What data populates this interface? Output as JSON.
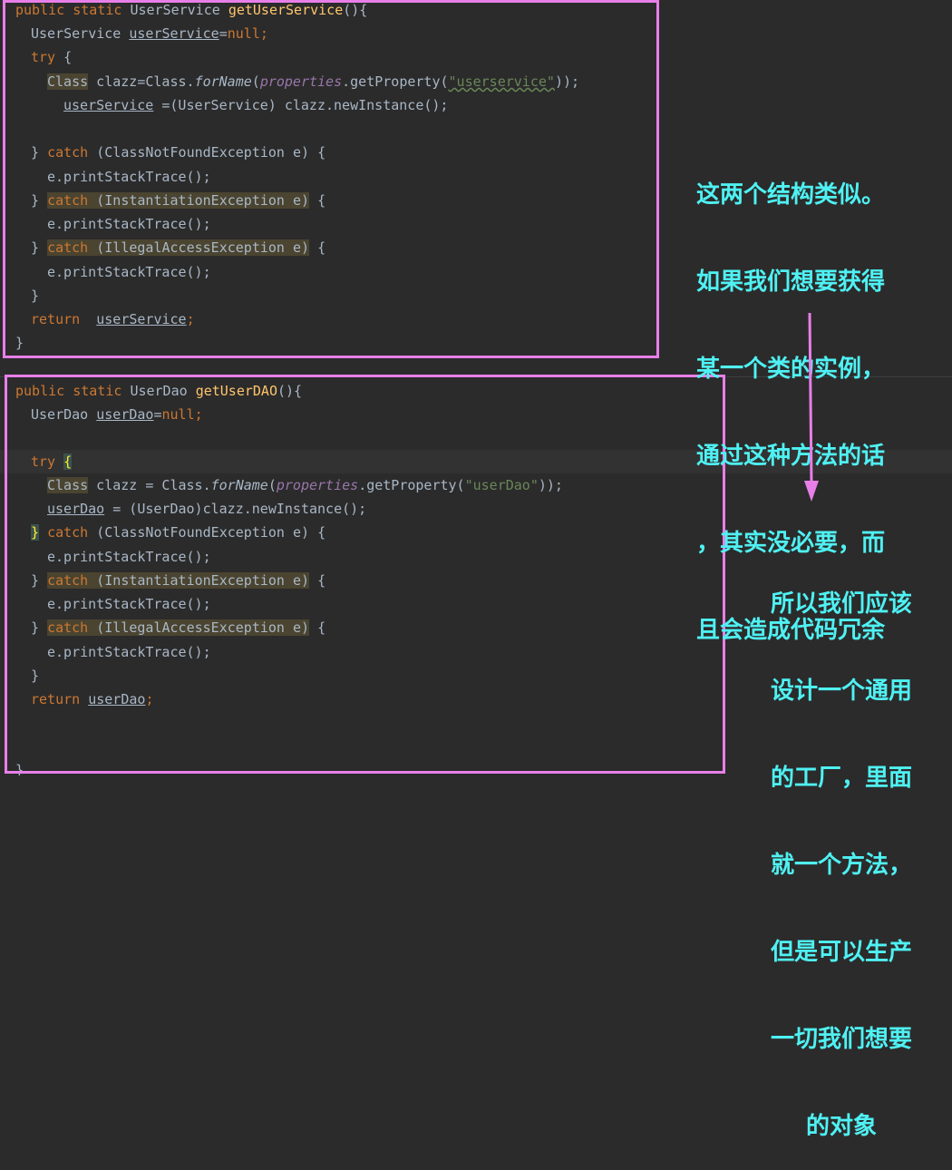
{
  "colors": {
    "background": "#2b2b2b",
    "keyword": "#cc7832",
    "function": "#ffc66d",
    "string": "#6a8759",
    "field": "#9876aa",
    "frame": "#e87fe8",
    "annotation": "#4ff1f3"
  },
  "code1": {
    "l1": {
      "kw": "public static",
      "type": "UserService",
      "fn": "getUserService",
      "rest": "(){"
    },
    "l2": {
      "type": "UserService",
      "var": "userService",
      "eq": "=",
      "nul": "null",
      "semi": ";"
    },
    "l3": {
      "kw": "try",
      "rest": " {"
    },
    "l4": {
      "cls": "Class",
      "a": " clazz=Class.",
      "m": "forName",
      "b": "(",
      "f": "properties",
      "c": ".getProperty(",
      "s": "\"userservice\"",
      "d": "));"
    },
    "l5": {
      "var": "userService",
      "rest": " =(UserService) clazz.newInstance();"
    },
    "l7": {
      "a": "} ",
      "kw": "catch",
      "b": " (ClassNotFoundException e) {"
    },
    "l8": "e.printStackTrace();",
    "l9": {
      "a": "} ",
      "kw": "catch",
      "b": " (InstantiationException e)",
      "c": " {"
    },
    "l10": "e.printStackTrace();",
    "l11": {
      "a": "} ",
      "kw": "catch",
      "b": " (IllegalAccessException e)",
      "c": " {"
    },
    "l12": "e.printStackTrace();",
    "l13": "}",
    "l14": {
      "kw": "return",
      "var": "userService",
      "semi": ";"
    },
    "l15": "}"
  },
  "code2": {
    "l1": {
      "kw": "public static",
      "type": "UserDao",
      "fn": "getUserDAO",
      "rest": "(){"
    },
    "l2": {
      "type": "UserDao",
      "var": "userDao",
      "eq": "=",
      "nul": "null",
      "semi": ";"
    },
    "l4": {
      "kw": "try",
      "brace": "{"
    },
    "l5": {
      "cls": "Class",
      "a": " clazz = Class.",
      "m": "forName",
      "b": "(",
      "f": "properties",
      "c": ".getProperty(",
      "s": "\"userDao\"",
      "d": "));"
    },
    "l6": {
      "var": "userDao",
      "rest": " = (UserDao)clazz.newInstance();"
    },
    "l7": {
      "brace": "}",
      "sp": " ",
      "kw": "catch",
      "b": " (ClassNotFoundException e) {"
    },
    "l8": "e.printStackTrace();",
    "l9": {
      "a": "} ",
      "kw": "catch",
      "b": " (InstantiationException e)",
      "c": " {"
    },
    "l10": "e.printStackTrace();",
    "l11": {
      "a": "} ",
      "kw": "catch",
      "b": " (IllegalAccessException e)",
      "c": " {"
    },
    "l12": "e.printStackTrace();",
    "l13": "}",
    "l14": {
      "kw": "return",
      "var": "userDao",
      "semi": ";"
    },
    "l17": "}"
  },
  "annotations": {
    "note1": [
      "这两个结构类似。",
      "如果我们想要获得",
      "某一个类的实例，",
      "通过这种方法的话",
      "，其实没必要，而",
      "且会造成代码冗余"
    ],
    "note2": [
      "所以我们应该",
      "设计一个通用",
      "的工厂，里面",
      "就一个方法，",
      "但是可以生产",
      "一切我们想要",
      "的对象"
    ]
  }
}
